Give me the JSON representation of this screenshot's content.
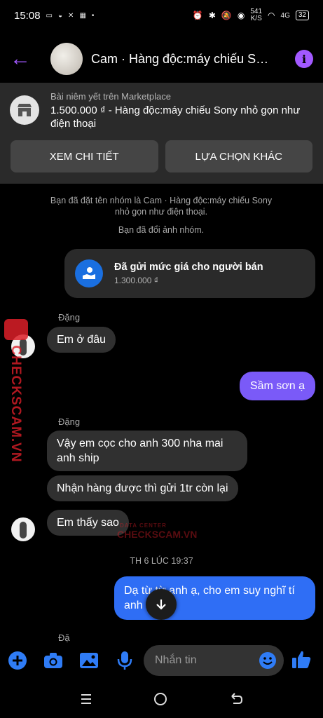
{
  "status_bar": {
    "time": "15:08",
    "net_speed": "541",
    "net_unit": "K/S",
    "signal": "4G",
    "battery": "32"
  },
  "header": {
    "title": "Cam · Hàng độc:máy chiếu Son..."
  },
  "marketplace": {
    "label": "Bài niêm yết trên Marketplace",
    "title": "1.500.000 ₫ - Hàng độc:máy chiếu Sony nhỏ gọn như điện thoại",
    "button_details": "XEM CHI TIẾT",
    "button_other": "LỰA CHỌN KHÁC"
  },
  "system_messages": {
    "renamed": "Bạn đã đặt tên nhóm là Cam · Hàng độc:máy chiếu Sony nhỏ gọn như điện thoại.",
    "photo_changed": "Bạn đã đổi ảnh nhóm."
  },
  "offer": {
    "title": "Đã gửi mức giá cho người bán",
    "price": "1.300.000 ₫"
  },
  "messages": {
    "sender1": "Đặng",
    "m1": "Em ở đâu",
    "m2": "Sầm sơn ạ",
    "sender2": "Đặng",
    "m3": "Vậy em cọc cho anh 300 nha mai anh ship",
    "m4": "Nhận hàng được thì gửi 1tr còn lại",
    "m5": "Em thấy sao",
    "timestamp": "TH 6 LÚC 19:37",
    "m6": "Dạ từ từ anh ạ, cho em suy nghĩ tí anh",
    "sender3": "Đặ"
  },
  "composer": {
    "placeholder": "Nhắn tin"
  },
  "watermark": {
    "brand": "CHECKSCAM.VN",
    "sub": "DATA CENTER"
  },
  "colors": {
    "accent": "#a259ff",
    "outgoing_purple": "#7a5af8",
    "outgoing_blue": "#2f6ef5",
    "icon_blue": "#1a6fe0"
  }
}
